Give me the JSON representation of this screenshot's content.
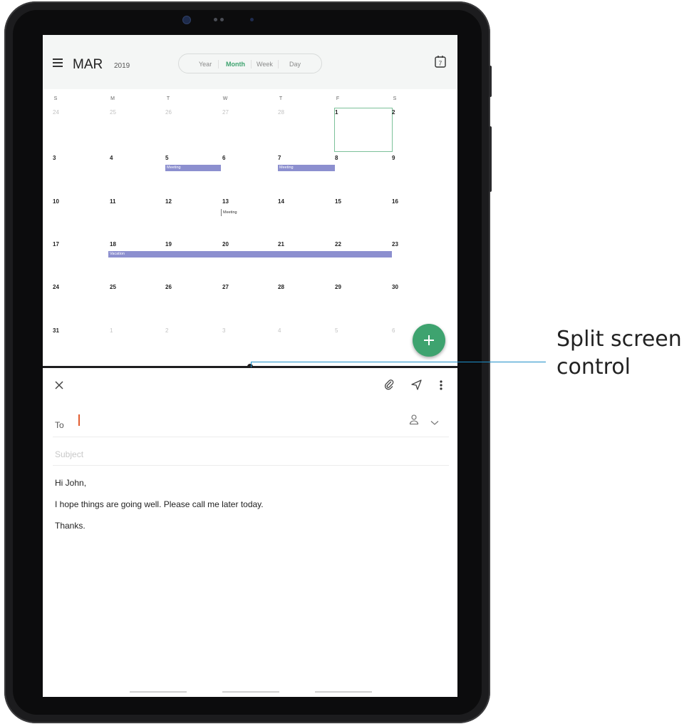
{
  "calendar": {
    "month": "MAR",
    "year": "2019",
    "view_tabs": [
      {
        "label": "Year",
        "active": false
      },
      {
        "label": "Month",
        "active": true
      },
      {
        "label": "Week",
        "active": false
      },
      {
        "label": "Day",
        "active": false
      }
    ],
    "today_icon_number": "7",
    "weekdays": [
      "S",
      "M",
      "T",
      "W",
      "T",
      "F",
      "S"
    ],
    "weeks": [
      [
        {
          "d": "24",
          "muted": true
        },
        {
          "d": "25",
          "muted": true
        },
        {
          "d": "26",
          "muted": true
        },
        {
          "d": "27",
          "muted": true
        },
        {
          "d": "28",
          "muted": true
        },
        {
          "d": "1",
          "muted": false
        },
        {
          "d": "2",
          "muted": false
        }
      ],
      [
        {
          "d": "3",
          "muted": false
        },
        {
          "d": "4",
          "muted": false
        },
        {
          "d": "5",
          "muted": false
        },
        {
          "d": "6",
          "muted": false
        },
        {
          "d": "7",
          "muted": false
        },
        {
          "d": "8",
          "muted": false
        },
        {
          "d": "9",
          "muted": false
        }
      ],
      [
        {
          "d": "10",
          "muted": false
        },
        {
          "d": "11",
          "muted": false
        },
        {
          "d": "12",
          "muted": false
        },
        {
          "d": "13",
          "muted": false
        },
        {
          "d": "14",
          "muted": false
        },
        {
          "d": "15",
          "muted": false
        },
        {
          "d": "16",
          "muted": false
        }
      ],
      [
        {
          "d": "17",
          "muted": false
        },
        {
          "d": "18",
          "muted": false
        },
        {
          "d": "19",
          "muted": false
        },
        {
          "d": "20",
          "muted": false
        },
        {
          "d": "21",
          "muted": false
        },
        {
          "d": "22",
          "muted": false
        },
        {
          "d": "23",
          "muted": false
        }
      ],
      [
        {
          "d": "24",
          "muted": false
        },
        {
          "d": "25",
          "muted": false
        },
        {
          "d": "26",
          "muted": false
        },
        {
          "d": "27",
          "muted": false
        },
        {
          "d": "28",
          "muted": false
        },
        {
          "d": "29",
          "muted": false
        },
        {
          "d": "30",
          "muted": false
        }
      ],
      [
        {
          "d": "31",
          "muted": false
        },
        {
          "d": "1",
          "muted": true
        },
        {
          "d": "2",
          "muted": true
        },
        {
          "d": "3",
          "muted": true
        },
        {
          "d": "4",
          "muted": true
        },
        {
          "d": "5",
          "muted": true
        },
        {
          "d": "6",
          "muted": true
        }
      ]
    ],
    "events": {
      "meeting_5": "Meeting",
      "meeting_7": "Meeting",
      "meeting_13": "Meeting",
      "vacation": "Vacation"
    },
    "event_color": "#8c8fcf",
    "accent_color": "#3ea36f"
  },
  "email": {
    "to_label": "To",
    "subject_placeholder": "Subject",
    "body_lines": [
      "Hi John,",
      "I hope things are going well. Please call me later today.",
      "Thanks."
    ]
  },
  "annotation": {
    "label_line1": "Split screen",
    "label_line2": "control",
    "line_color": "#1e90c9"
  },
  "icons": [
    "menu-icon",
    "today-calendar-icon",
    "add-icon",
    "close-icon",
    "attach-icon",
    "send-icon",
    "more-options-icon",
    "contact-icon",
    "chevron-down-icon"
  ]
}
